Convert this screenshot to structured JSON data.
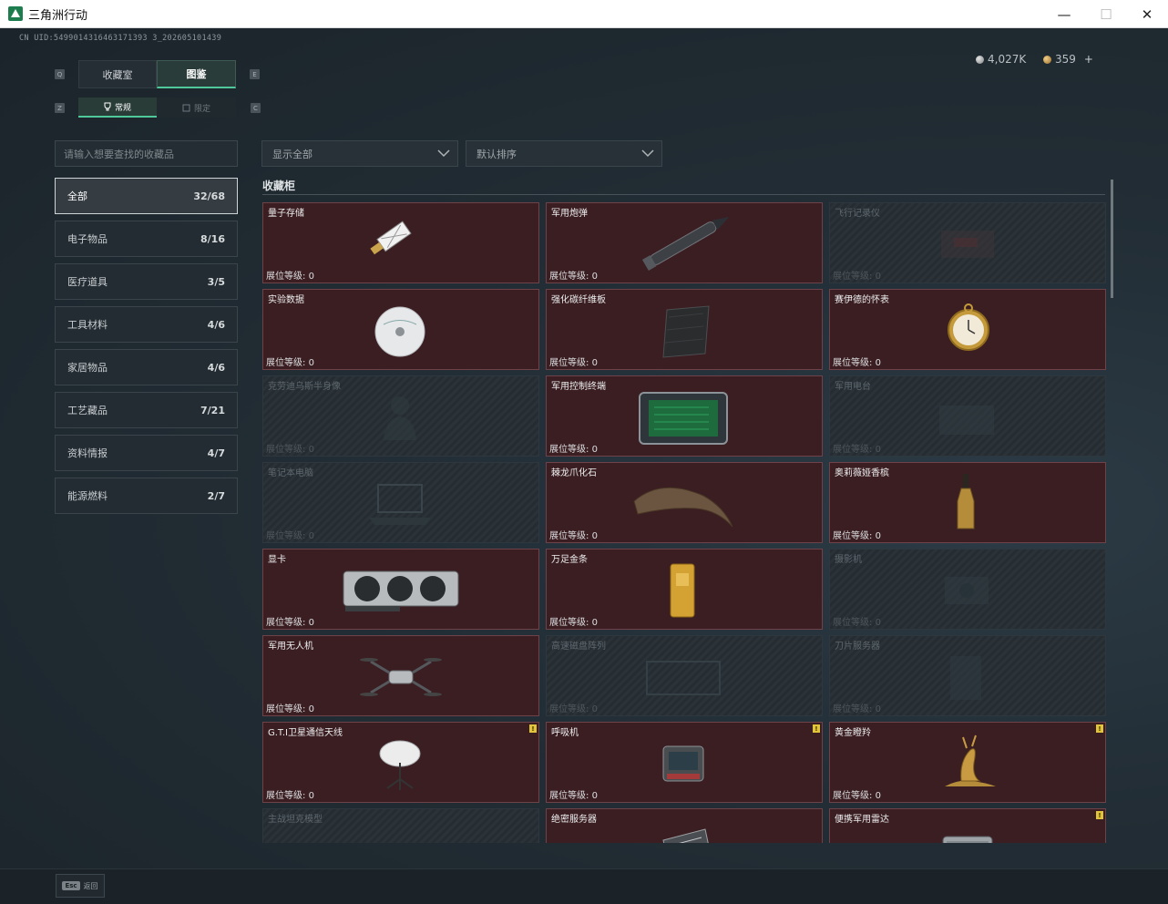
{
  "window": {
    "title": "三角洲行动",
    "minimize_icon": "—",
    "maximize_icon": "☐",
    "close_icon": "✕"
  },
  "header": {
    "uid": "CN UID:5499014316463171393 3_202605101439",
    "currency_silver": "4,027K",
    "currency_gold": "359",
    "add_label": "+"
  },
  "tabs": {
    "collection": "收藏室",
    "catalog": "图鉴",
    "q_key": "Q",
    "e_key": "E"
  },
  "subtabs": {
    "normal": "常规",
    "limited": "限定",
    "z_key": "Z",
    "c_key": "C"
  },
  "search": {
    "placeholder": "请输入想要查找的收藏品"
  },
  "filters": {
    "show": "显示全部",
    "sort": "默认排序"
  },
  "categories": [
    {
      "label": "全部",
      "count": "32/68"
    },
    {
      "label": "电子物品",
      "count": "8/16"
    },
    {
      "label": "医疗道具",
      "count": "3/5"
    },
    {
      "label": "工具材料",
      "count": "4/6"
    },
    {
      "label": "家居物品",
      "count": "4/6"
    },
    {
      "label": "工艺藏品",
      "count": "7/21"
    },
    {
      "label": "资料情报",
      "count": "4/7"
    },
    {
      "label": "能源燃料",
      "count": "2/7"
    }
  ],
  "section_title": "收藏柜",
  "level_prefix": "展位等级: ",
  "items": [
    {
      "name": "量子存储",
      "level": "0",
      "owned": true,
      "icon": "usb-drive-icon"
    },
    {
      "name": "军用炮弹",
      "level": "0",
      "owned": true,
      "icon": "artillery-shell-icon"
    },
    {
      "name": "飞行记录仪",
      "level": "0",
      "owned": false,
      "icon": "flight-recorder-icon"
    },
    {
      "name": "实验数据",
      "level": "0",
      "owned": true,
      "icon": "cd-disc-icon"
    },
    {
      "name": "强化碳纤维板",
      "level": "0",
      "owned": true,
      "icon": "carbon-plate-icon"
    },
    {
      "name": "赛伊德的怀表",
      "level": "0",
      "owned": true,
      "icon": "pocket-watch-icon"
    },
    {
      "name": "克劳迪乌斯半身像",
      "level": "0",
      "owned": false,
      "icon": "bust-statue-icon"
    },
    {
      "name": "军用控制终端",
      "level": "0",
      "owned": true,
      "icon": "control-terminal-icon"
    },
    {
      "name": "军用电台",
      "level": "0",
      "owned": false,
      "icon": "radio-icon"
    },
    {
      "name": "笔记本电脑",
      "level": "0",
      "owned": false,
      "icon": "laptop-icon"
    },
    {
      "name": "棘龙爪化石",
      "level": "0",
      "owned": true,
      "icon": "claw-fossil-icon"
    },
    {
      "name": "奥莉薇娅香槟",
      "level": "0",
      "owned": true,
      "icon": "champagne-icon"
    },
    {
      "name": "显卡",
      "level": "0",
      "owned": true,
      "icon": "graphics-card-icon"
    },
    {
      "name": "万足金条",
      "level": "0",
      "owned": true,
      "icon": "gold-bar-icon"
    },
    {
      "name": "摄影机",
      "level": "0",
      "owned": false,
      "icon": "camera-icon"
    },
    {
      "name": "军用无人机",
      "level": "0",
      "owned": true,
      "icon": "drone-icon"
    },
    {
      "name": "高速磁盘阵列",
      "level": "0",
      "owned": false,
      "icon": "disk-array-icon"
    },
    {
      "name": "刀片服务器",
      "level": "0",
      "owned": false,
      "icon": "blade-server-icon"
    },
    {
      "name": "G.T.I卫星通信天线",
      "level": "0",
      "owned": true,
      "icon": "satellite-dish-icon",
      "new": true
    },
    {
      "name": "呼吸机",
      "level": "0",
      "owned": true,
      "icon": "ventilator-icon",
      "new": true
    },
    {
      "name": "黄金瞪羚",
      "level": "0",
      "owned": true,
      "icon": "golden-gazelle-icon",
      "new": true
    },
    {
      "name": "主战坦克模型",
      "level": "",
      "owned": false,
      "icon": "tank-model-icon"
    },
    {
      "name": "绝密服务器",
      "level": "",
      "owned": true,
      "icon": "server-icon"
    },
    {
      "name": "便携军用雷达",
      "level": "",
      "owned": true,
      "icon": "radar-icon",
      "new": true
    }
  ],
  "new_badge": "!",
  "footer": {
    "esc_key": "Esc",
    "esc_label": "返回"
  },
  "colors": {
    "accent": "#4fc89a",
    "owned_card": "#3b1e22",
    "locked_card": "#252d33",
    "new_badge": "#e1c43a"
  }
}
